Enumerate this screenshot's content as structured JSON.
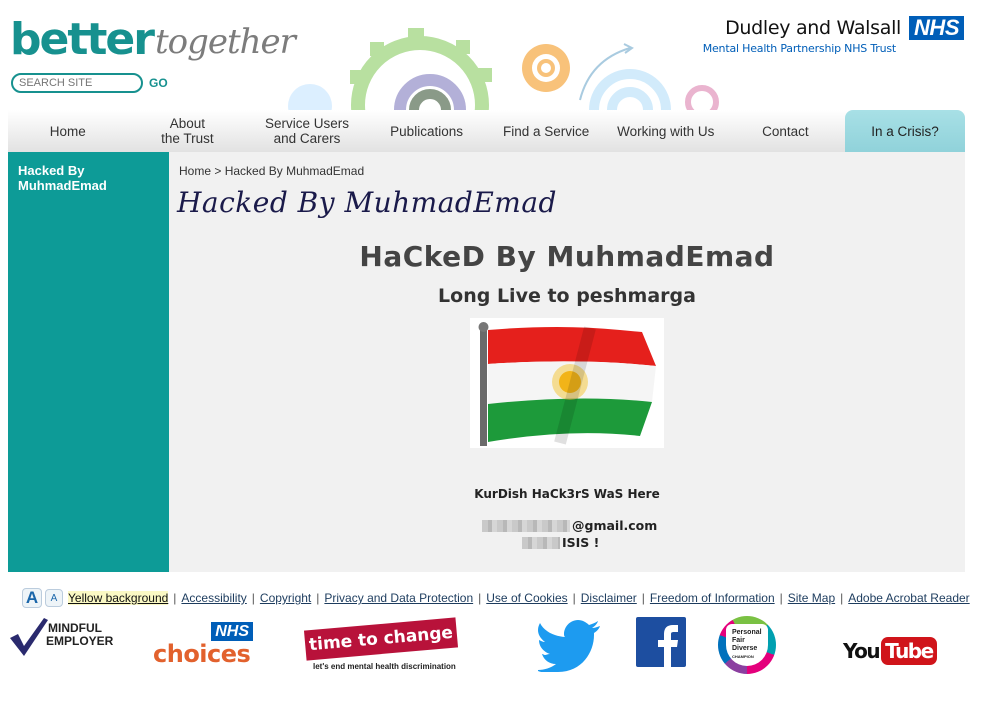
{
  "header": {
    "logo_primary": "better",
    "logo_secondary": "together",
    "search": {
      "placeholder": "SEARCH SITE",
      "value": "",
      "go_label": "GO"
    },
    "trust_name": "Dudley and Walsall",
    "nhs_badge": "NHS",
    "trust_subtitle": "Mental Health Partnership NHS Trust"
  },
  "nav": {
    "items": [
      {
        "label": "Home"
      },
      {
        "label": "About\nthe Trust",
        "line1": "About",
        "line2": "the Trust"
      },
      {
        "label": "Service Users and Carers",
        "line1": "Service Users",
        "line2": "and Carers"
      },
      {
        "label": "Publications"
      },
      {
        "label": "Find a Service"
      },
      {
        "label": "Working with Us"
      },
      {
        "label": "Contact"
      },
      {
        "label": "In a Crisis?"
      }
    ]
  },
  "sidebar": {
    "items": [
      {
        "label": "Hacked By MuhmadEmad"
      }
    ]
  },
  "content": {
    "breadcrumb": {
      "home": "Home",
      "separator": ">",
      "current": "Hacked By MuhmadEmad"
    },
    "page_title": "Hacked By MuhmadEmad",
    "hack_title": "HaCkeD By MuhmadEmad",
    "hack_subtitle": "Long Live to peshmarga",
    "flag_image": "kurdistan-flag",
    "hack_line": "KurDish HaCk3rS WaS Here",
    "email_suffix": "@gmail.com",
    "isis_text": "ISIS !"
  },
  "footer": {
    "font_size_large": "A",
    "font_size_small": "A",
    "links": [
      {
        "label": "Yellow background"
      },
      {
        "label": "Accessibility"
      },
      {
        "label": "Copyright"
      },
      {
        "label": "Privacy and Data Protection"
      },
      {
        "label": "Use of Cookies"
      },
      {
        "label": "Disclaimer"
      },
      {
        "label": "Freedom of Information"
      },
      {
        "label": "Site Map"
      },
      {
        "label": "Adobe Acrobat Reader"
      }
    ],
    "separator": "|",
    "logos": {
      "mindful_line1": "MINDFUL",
      "mindful_line2": "EMPLOYER",
      "nhs_choices_badge": "NHS",
      "nhs_choices_text": "choices",
      "time_to_change": "time to change",
      "time_to_change_tagline": "let's end mental health discrimination",
      "pfd_line1": "Personal",
      "pfd_line2": "Fair",
      "pfd_line3": "Diverse",
      "pfd_line4": "CHAMPION",
      "youtube_you": "You",
      "youtube_tube": "Tube"
    }
  },
  "colors": {
    "brand_teal": "#17918f",
    "sidebar_teal": "#0d9b97",
    "nhs_blue": "#005eb8",
    "crisis_tab": "#a8e0e6",
    "content_bg": "#f1f1f1"
  }
}
